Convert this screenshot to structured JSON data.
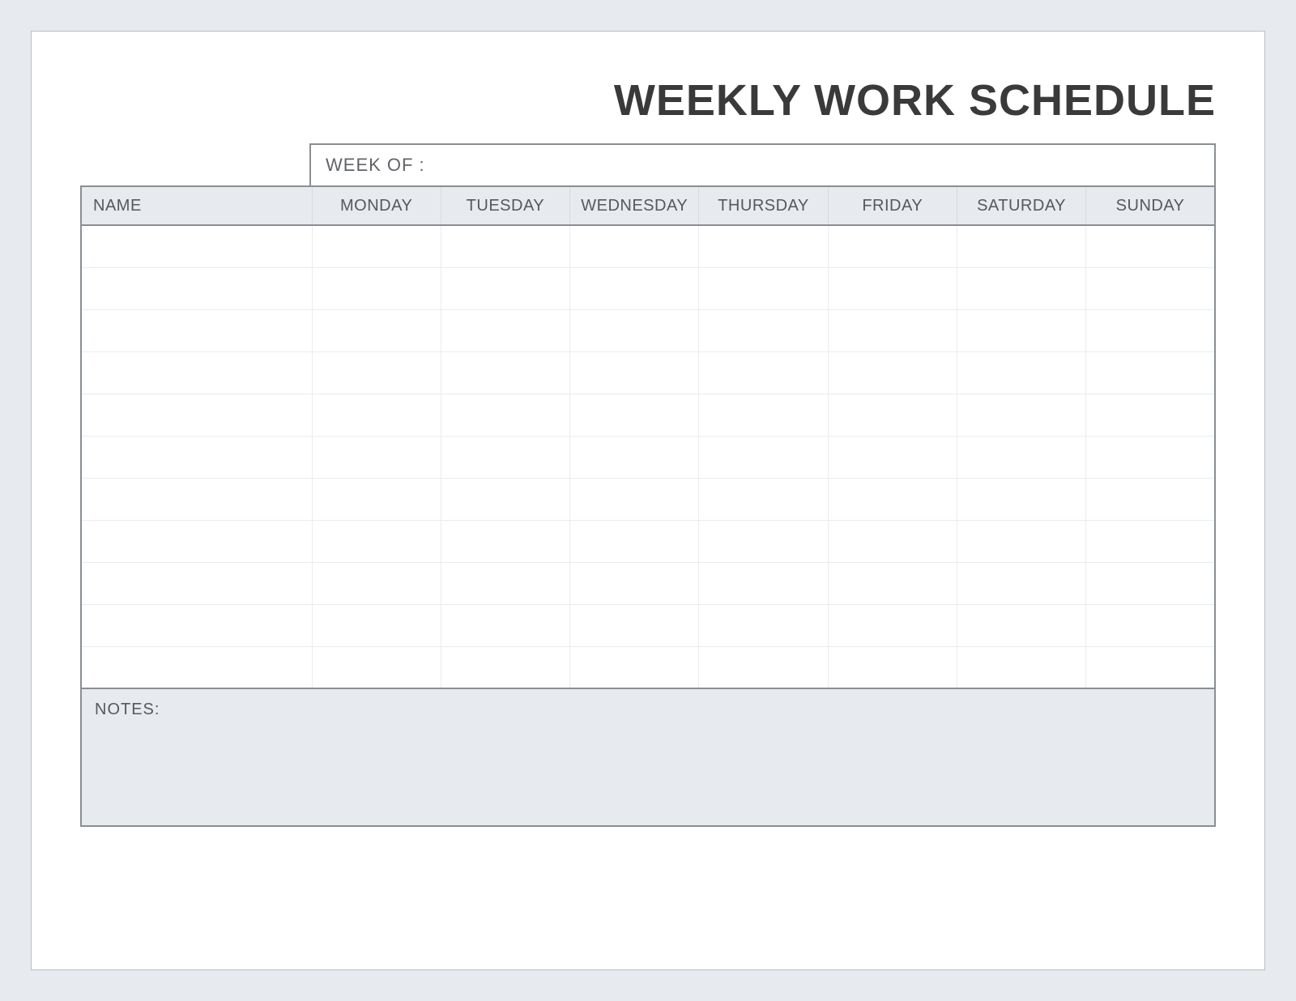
{
  "title": "WEEKLY WORK SCHEDULE",
  "week_of_label": "WEEK OF :",
  "week_of_value": "",
  "columns": {
    "name": "NAME",
    "days": [
      "MONDAY",
      "TUESDAY",
      "WEDNESDAY",
      "THURSDAY",
      "FRIDAY",
      "SATURDAY",
      "SUNDAY"
    ]
  },
  "rows": [
    {
      "name": "",
      "mon": "",
      "tue": "",
      "wed": "",
      "thu": "",
      "fri": "",
      "sat": "",
      "sun": ""
    },
    {
      "name": "",
      "mon": "",
      "tue": "",
      "wed": "",
      "thu": "",
      "fri": "",
      "sat": "",
      "sun": ""
    },
    {
      "name": "",
      "mon": "",
      "tue": "",
      "wed": "",
      "thu": "",
      "fri": "",
      "sat": "",
      "sun": ""
    },
    {
      "name": "",
      "mon": "",
      "tue": "",
      "wed": "",
      "thu": "",
      "fri": "",
      "sat": "",
      "sun": ""
    },
    {
      "name": "",
      "mon": "",
      "tue": "",
      "wed": "",
      "thu": "",
      "fri": "",
      "sat": "",
      "sun": ""
    },
    {
      "name": "",
      "mon": "",
      "tue": "",
      "wed": "",
      "thu": "",
      "fri": "",
      "sat": "",
      "sun": ""
    },
    {
      "name": "",
      "mon": "",
      "tue": "",
      "wed": "",
      "thu": "",
      "fri": "",
      "sat": "",
      "sun": ""
    },
    {
      "name": "",
      "mon": "",
      "tue": "",
      "wed": "",
      "thu": "",
      "fri": "",
      "sat": "",
      "sun": ""
    },
    {
      "name": "",
      "mon": "",
      "tue": "",
      "wed": "",
      "thu": "",
      "fri": "",
      "sat": "",
      "sun": ""
    },
    {
      "name": "",
      "mon": "",
      "tue": "",
      "wed": "",
      "thu": "",
      "fri": "",
      "sat": "",
      "sun": ""
    },
    {
      "name": "",
      "mon": "",
      "tue": "",
      "wed": "",
      "thu": "",
      "fri": "",
      "sat": "",
      "sun": ""
    }
  ],
  "notes_label": "NOTES:",
  "notes_value": ""
}
